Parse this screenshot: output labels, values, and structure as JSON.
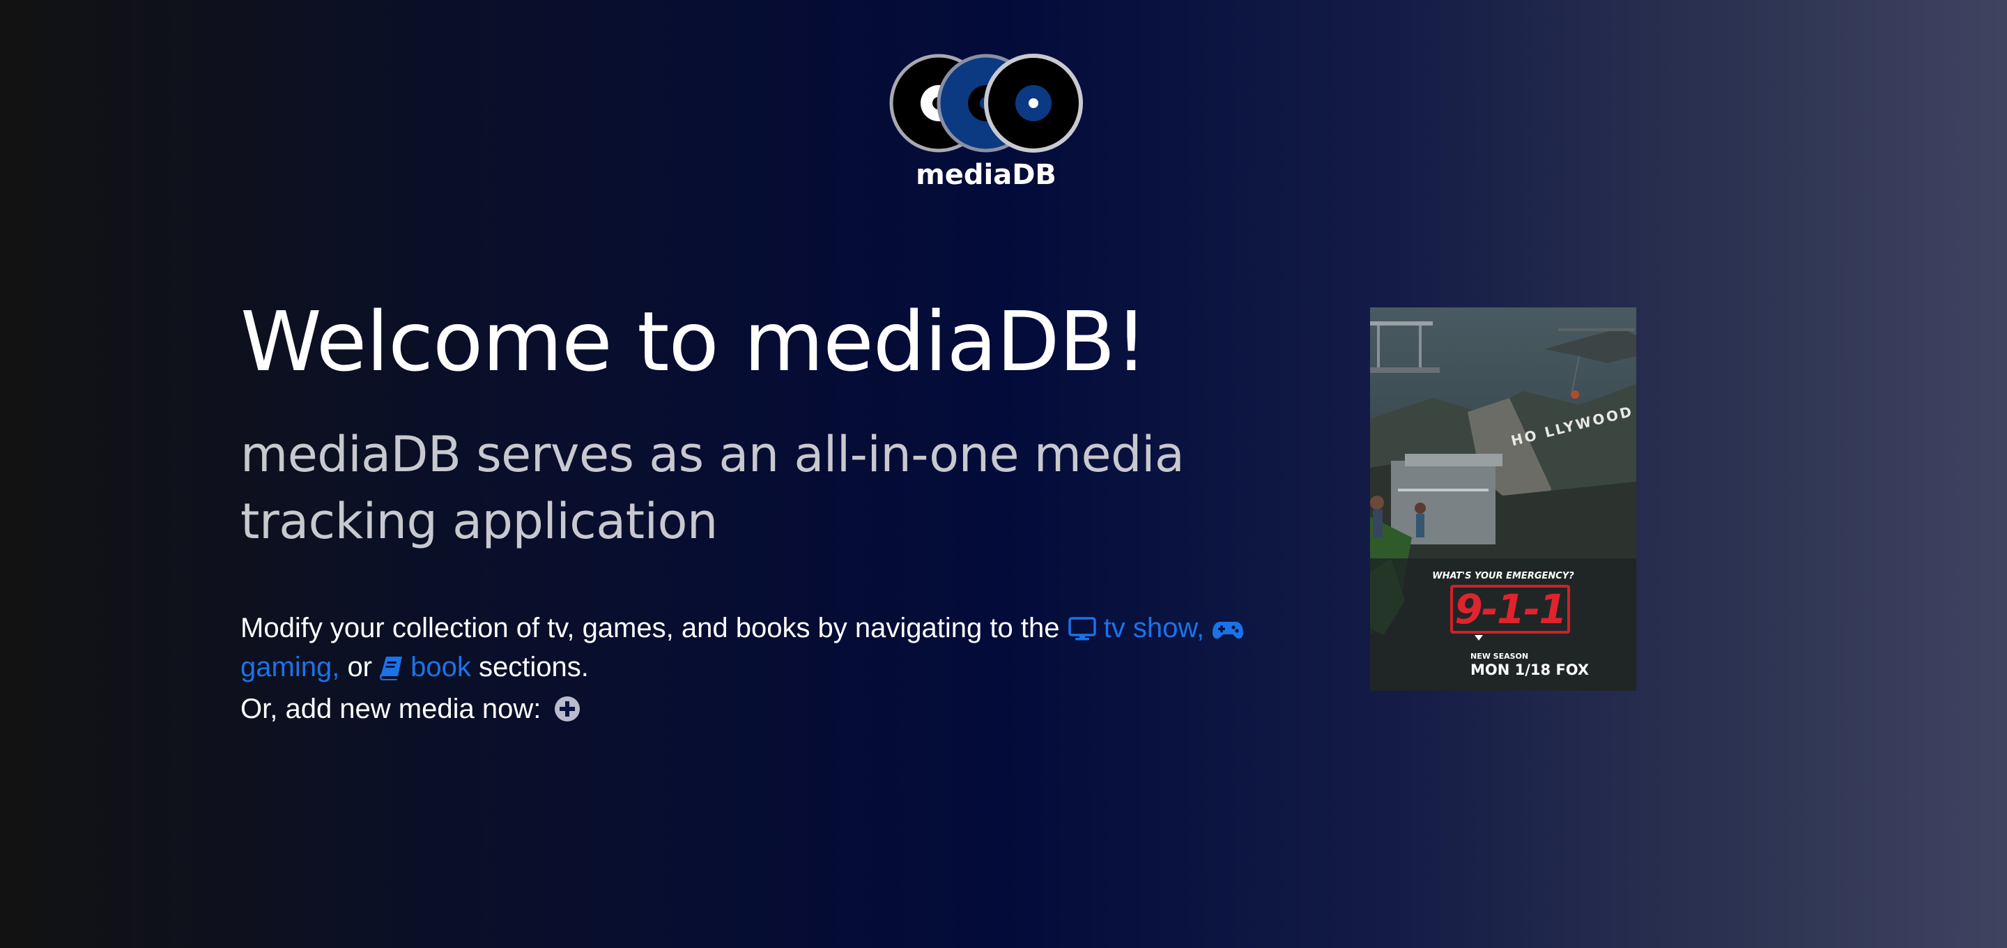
{
  "brand": {
    "name": "mediaDB"
  },
  "hero": {
    "title": "Welcome to mediaDB!",
    "subtitle": "mediaDB serves as an all-in-one media tracking application"
  },
  "intro": {
    "prefix": "Modify your collection of tv, games, and books by navigating to the",
    "tv_link": "tv show,",
    "gaming_link": "gaming,",
    "or_text": "or",
    "book_link": "book",
    "suffix": "sections.",
    "tv_icon": "monitor-icon",
    "gaming_icon": "gamepad-icon",
    "book_icon": "book-icon"
  },
  "add_media": {
    "label": "Or, add new media now:",
    "icon": "plus-circle-icon"
  },
  "poster": {
    "tagline": "WHAT'S YOUR EMERGENCY?",
    "show_logo": "9-1-1",
    "sign_text": "HO  LLYWOOD",
    "season_label": "NEW SEASON",
    "airdate": "MON 1/18 FOX"
  },
  "colors": {
    "link": "#1a73e8",
    "logo_blue": "#0b3a82",
    "subtitle_gray": "#c8c9cf",
    "poster_red": "#d2202a"
  }
}
